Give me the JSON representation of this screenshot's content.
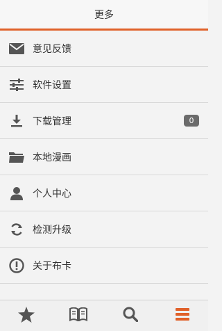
{
  "header": {
    "title": "更多"
  },
  "menu": {
    "items": [
      {
        "label": "意见反馈",
        "icon": "envelope-icon"
      },
      {
        "label": "软件设置",
        "icon": "sliders-icon"
      },
      {
        "label": "下载管理",
        "icon": "download-icon",
        "badge": "0"
      },
      {
        "label": "本地漫画",
        "icon": "folder-icon"
      },
      {
        "label": "个人中心",
        "icon": "user-icon"
      },
      {
        "label": "检测升级",
        "icon": "refresh-icon"
      },
      {
        "label": "关于布卡",
        "icon": "info-icon"
      }
    ]
  },
  "tabbar": {
    "tabs": [
      {
        "icon": "star-icon",
        "active": false
      },
      {
        "icon": "book-icon",
        "active": false
      },
      {
        "icon": "search-icon",
        "active": false
      },
      {
        "icon": "menu-icon",
        "active": true
      }
    ]
  },
  "colors": {
    "accent": "#e0612a",
    "icon": "#555555",
    "badge": "#6b6b6b"
  }
}
